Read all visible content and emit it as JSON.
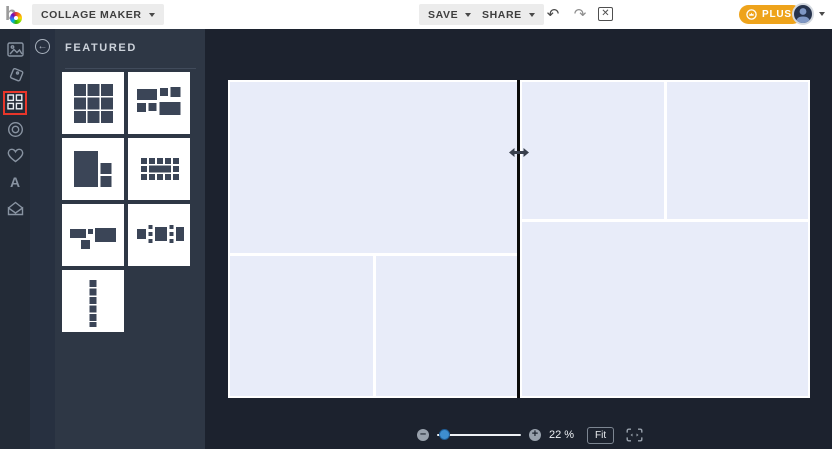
{
  "topbar": {
    "app_menu_label": "COLLAGE MAKER",
    "save_label": "SAVE",
    "share_label": "SHARE",
    "plus_label": "PLUS",
    "undo_glyph": "↶",
    "redo_glyph": "↷",
    "close_glyph": "✕",
    "icons": [
      "befunky-logo",
      "undo-icon",
      "redo-icon",
      "close-icon",
      "plus-badge-icon",
      "avatar",
      "caret-down-icon"
    ]
  },
  "sidebar": {
    "icons": [
      "image-icon",
      "tag-icon",
      "grid-icon",
      "target-icon",
      "heart-icon",
      "text-icon",
      "envelope-icon"
    ],
    "active_icon": "grid-icon",
    "text_icon_glyph": "A",
    "annotation_color": "#e8362a"
  },
  "panel": {
    "title": "FEATURED",
    "back_icon": "back-arrow-icon",
    "back_glyph": "←",
    "layout_thumbnails": [
      "grid-3x3",
      "mosaic-mixed",
      "big-left-split-right",
      "border-frame",
      "mosaic-horizontal",
      "filmstrip-mixed",
      "vertical-strip"
    ]
  },
  "canvas": {
    "cells": 6,
    "cell_color": "#e8ecf9",
    "divider_color": "#0b0b0b",
    "drag_cursor": "resize-horizontal"
  },
  "zoombar": {
    "minus_glyph": "–",
    "plus_glyph": "+",
    "zoom_percent": "22 %",
    "fit_label": "Fit",
    "slider_value": 22,
    "icons": [
      "zoom-out-icon",
      "zoom-in-icon",
      "fit-screen-icon"
    ]
  },
  "colors": {
    "plus_badge": "#eea31b",
    "slider_thumb": "#3e8ed0",
    "rail_bg": "#232b37",
    "panel_bg": "#2e3745",
    "canvas_bg": "#1c222e",
    "cell": "#e8ecf9",
    "annotation_red": "#e8362a"
  }
}
